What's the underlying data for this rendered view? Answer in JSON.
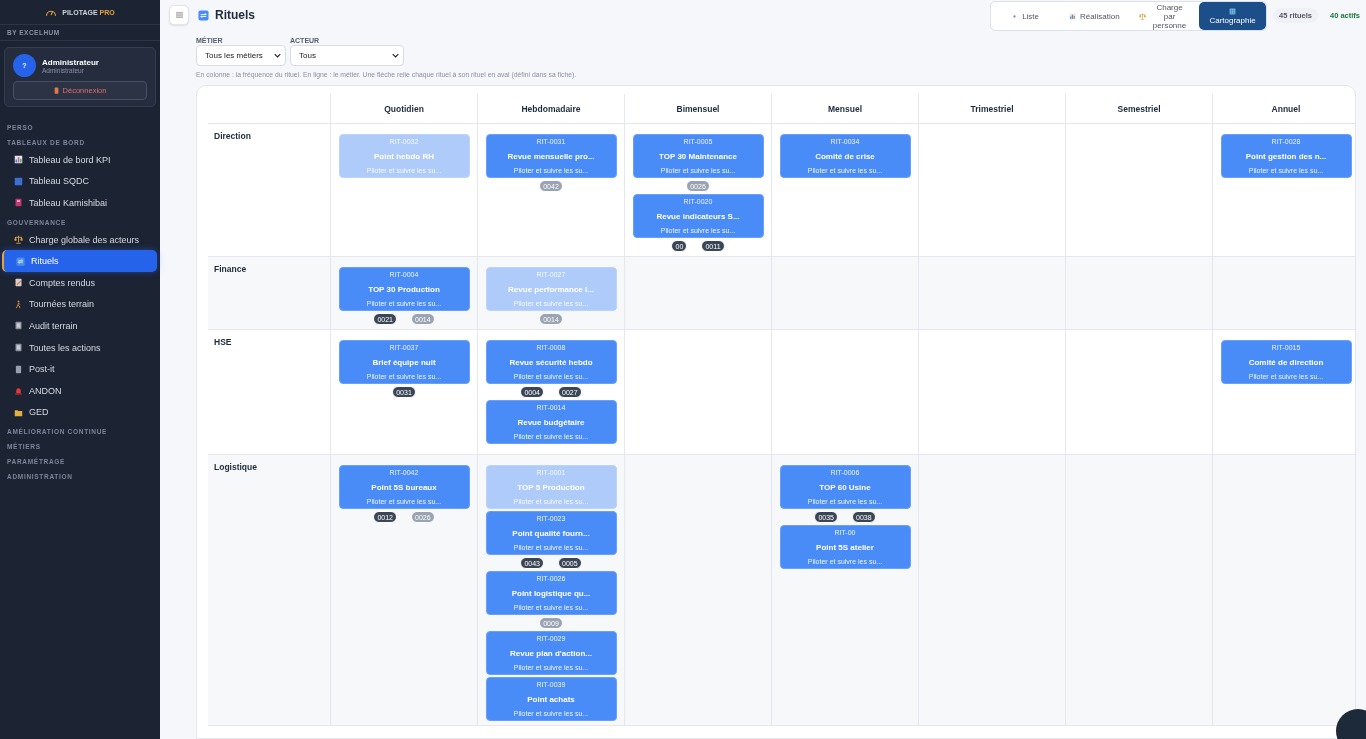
{
  "brand": {
    "name": "PILOTAGE",
    "accent": "PRO",
    "tagline": "BY EXCELHUM"
  },
  "user": {
    "avatar": "?",
    "name": "Administrateur",
    "role": "Administrateur",
    "logout": "Déconnexion"
  },
  "sidebar": [
    {
      "kind": "section",
      "label": "PERSO"
    },
    {
      "kind": "section",
      "label": "TABLEAUX DE BORD"
    },
    {
      "kind": "chart",
      "label": "Tableau de bord KPI",
      "selected": false
    },
    {
      "kind": "square",
      "label": "Tableau SQDC",
      "selected": false
    },
    {
      "kind": "book",
      "label": "Tableau Kamishibai",
      "selected": false
    },
    {
      "kind": "section",
      "label": "GOUVERNANCE"
    },
    {
      "kind": "scale",
      "label": "Charge globale des acteurs",
      "selected": false
    },
    {
      "kind": "loop",
      "label": "Rituels",
      "selected": true
    },
    {
      "kind": "doc",
      "label": "Comptes rendus",
      "selected": false
    },
    {
      "kind": "walker",
      "label": "Tournées terrain",
      "selected": false
    },
    {
      "kind": "clipboard",
      "label": "Audit terrain",
      "selected": false
    },
    {
      "kind": "clipboard",
      "label": "Toutes les actions",
      "selected": false
    },
    {
      "kind": "note",
      "label": "Post-it",
      "selected": false
    },
    {
      "kind": "siren",
      "label": "ANDON",
      "selected": false
    },
    {
      "kind": "folder",
      "label": "GED",
      "selected": false
    },
    {
      "kind": "section",
      "label": "AMÉLIORATION CONTINUE"
    },
    {
      "kind": "section",
      "label": "MÉTIERS"
    },
    {
      "kind": "section",
      "label": "PARAMÉTRAGE"
    },
    {
      "kind": "section",
      "label": "ADMINISTRATION"
    }
  ],
  "page": {
    "title": "Rituels"
  },
  "views": [
    {
      "kind": "list",
      "label": "Liste",
      "selected": false
    },
    {
      "kind": "chart",
      "label": "Réalisation",
      "selected": false
    },
    {
      "kind": "scale",
      "label": "Charge par personne",
      "selected": false
    },
    {
      "kind": "map",
      "label": "Cartographie",
      "selected": true
    }
  ],
  "counts": [
    {
      "kind": "neutral",
      "label": "45 rituels"
    },
    {
      "kind": "success",
      "label": "40 actifs"
    }
  ],
  "filters": [
    {
      "label": "MÉTIER",
      "value": "Tous les métiers"
    },
    {
      "label": "ACTEUR",
      "value": "Tous"
    }
  ],
  "hint": "En colonne : la fréquence du rituel. En ligne : le métier. Une flèche relie chaque rituel à son rituel en aval (défini dans sa fiche).",
  "columns": [
    "Quotidien",
    "Hebdomadaire",
    "Bimensuel",
    "Mensuel",
    "Trimestriel",
    "Semestriel",
    "Annuel"
  ],
  "rows": [
    {
      "name": "Direction",
      "cells": [
        [
          {
            "id": "RIT-0032",
            "title": "Point hebdo RH",
            "subtitle": "Piloter et suivre les su...",
            "faded": true
          }
        ],
        [
          {
            "id": "RIT-0031",
            "title": "Revue mensuelle pro...",
            "subtitle": "Piloter et suivre les su...",
            "faded": false,
            "links": [
              {
                "label": "0042",
                "dark": false
              }
            ]
          }
        ],
        [
          {
            "id": "RIT-0005",
            "title": "TOP 30 Maintenance",
            "subtitle": "Piloter et suivre les su...",
            "faded": false,
            "links": [
              {
                "label": "0026",
                "dark": false
              }
            ]
          },
          {
            "id": "RIT-0020",
            "title": "Revue indicateurs S...",
            "subtitle": "Piloter et suivre les su...",
            "faded": false,
            "links": [
              {
                "label": "00",
                "dark": true
              },
              {
                "label": "0011",
                "dark": true
              }
            ]
          }
        ],
        [
          {
            "id": "RIT-0034",
            "title": "Comité de crise",
            "subtitle": "Piloter et suivre les su...",
            "faded": false
          }
        ],
        [],
        [],
        [
          {
            "id": "RIT-0028",
            "title": "Point gestion des n...",
            "subtitle": "Piloter et suivre les su...",
            "faded": false
          }
        ]
      ]
    },
    {
      "name": "Finance",
      "cells": [
        [
          {
            "id": "RIT-0004",
            "title": "TOP 30 Production",
            "subtitle": "Piloter et suivre les su...",
            "faded": false,
            "links": [
              {
                "label": "0021",
                "dark": true
              },
              {
                "label": "0014",
                "dark": false
              }
            ]
          }
        ],
        [
          {
            "id": "RIT-0027",
            "title": "Revue performance l...",
            "subtitle": "Piloter et suivre les su...",
            "faded": true,
            "links": [
              {
                "label": "0014",
                "dark": false
              }
            ]
          }
        ],
        [],
        [],
        [],
        [],
        []
      ]
    },
    {
      "name": "HSE",
      "cells": [
        [
          {
            "id": "RIT-0037",
            "title": "Brief équipe nuit",
            "subtitle": "Piloter et suivre les su...",
            "faded": false,
            "links": [
              {
                "label": "0031",
                "dark": true
              }
            ]
          }
        ],
        [
          {
            "id": "RIT-0008",
            "title": "Revue sécurité hebdo",
            "subtitle": "Piloter et suivre les su...",
            "faded": false,
            "links": [
              {
                "label": "0004",
                "dark": true
              },
              {
                "label": "0027",
                "dark": true
              }
            ]
          },
          {
            "id": "RIT-0014",
            "title": "Revue budgétaire",
            "subtitle": "Piloter et suivre les su...",
            "faded": false
          }
        ],
        [],
        [],
        [],
        [],
        [
          {
            "id": "RIT-0015",
            "title": "Comité de direction",
            "subtitle": "Piloter et suivre les su...",
            "faded": false
          }
        ]
      ]
    },
    {
      "name": "Logistique",
      "cells": [
        [
          {
            "id": "RIT-0042",
            "title": "Point 5S bureaux",
            "subtitle": "Piloter et suivre les su...",
            "faded": false,
            "links": [
              {
                "label": "0012",
                "dark": true
              },
              {
                "label": "0026",
                "dark": false
              }
            ]
          }
        ],
        [
          {
            "id": "RIT-0001",
            "title": "TOP 5 Production",
            "subtitle": "Piloter et suivre les su...",
            "faded": true
          },
          {
            "id": "RIT-0023",
            "title": "Point qualité fourn...",
            "subtitle": "Piloter et suivre les su...",
            "faded": false,
            "links": [
              {
                "label": "0043",
                "dark": true
              },
              {
                "label": "0005",
                "dark": true
              }
            ]
          },
          {
            "id": "RIT-0026",
            "title": "Point logistique qu...",
            "subtitle": "Piloter et suivre les su...",
            "faded": false,
            "links": [
              {
                "label": "0009",
                "dark": false
              }
            ]
          },
          {
            "id": "RIT-0029",
            "title": "Revue plan d'action...",
            "subtitle": "Piloter et suivre les su...",
            "faded": false
          },
          {
            "id": "RIT-0039",
            "title": "Point achats",
            "subtitle": "Piloter et suivre les su...",
            "faded": false
          }
        ],
        [],
        [
          {
            "id": "RIT-0006",
            "title": "TOP 60 Usine",
            "subtitle": "Piloter et suivre les su...",
            "faded": false,
            "links": [
              {
                "label": "0035",
                "dark": true
              },
              {
                "label": "0038",
                "dark": true
              }
            ]
          },
          {
            "id": "RIT-00",
            "title": "Point 5S atelier",
            "subtitle": "Piloter et suivre les su...",
            "faded": false
          }
        ],
        [],
        [],
        []
      ]
    }
  ]
}
